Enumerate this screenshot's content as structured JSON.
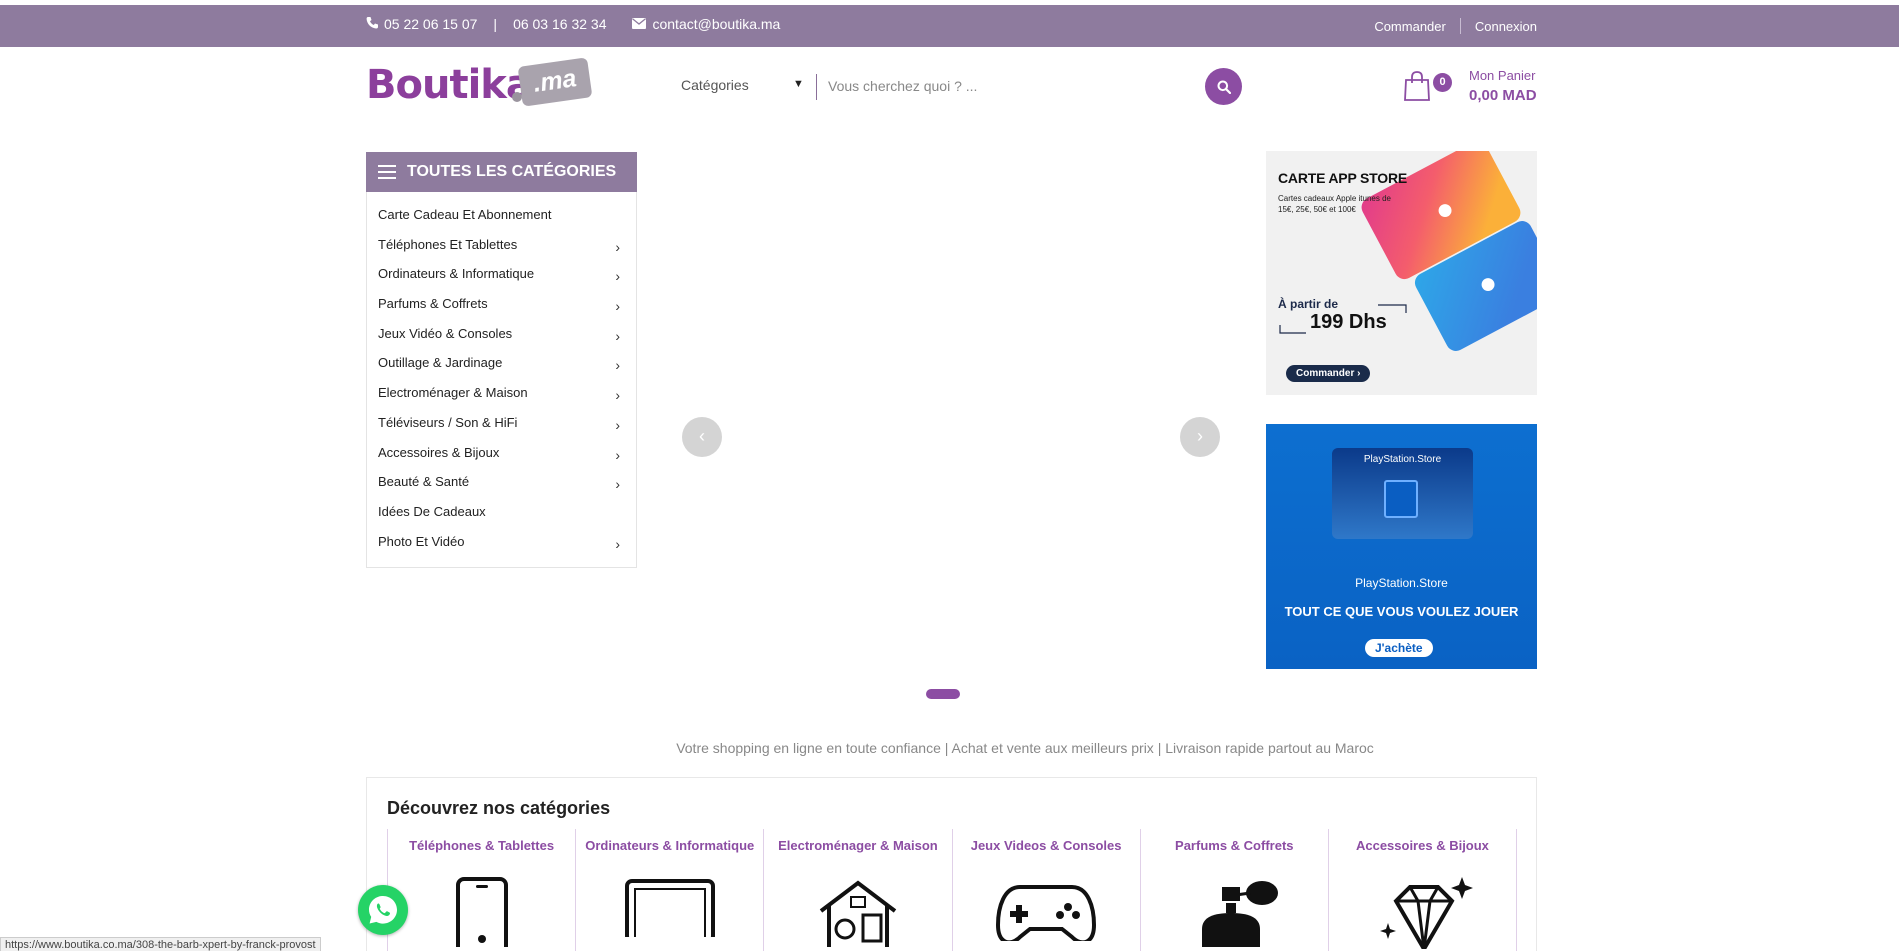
{
  "topbar": {
    "phone1": "05 22 06 15 07",
    "separator": "|",
    "phone2": "06 03 16 32 34",
    "email": "contact@boutika.ma",
    "links": [
      "Commander",
      "Connexion"
    ]
  },
  "header": {
    "logo_word": "Boutika",
    "logo_tag": ".ma",
    "category_select": "Catégories",
    "search_placeholder": "Vous cherchez quoi ? ...",
    "cart_count": "0",
    "cart_label": "Mon Panier",
    "cart_total": "0,00 MAD"
  },
  "sidebar": {
    "title": "TOUTES LES CATÉGORIES",
    "items": [
      {
        "label": "Carte Cadeau Et Abonnement",
        "has_children": false
      },
      {
        "label": "Téléphones Et Tablettes",
        "has_children": true
      },
      {
        "label": "Ordinateurs & Informatique",
        "has_children": true
      },
      {
        "label": "Parfums & Coffrets",
        "has_children": true
      },
      {
        "label": "Jeux Vidéo & Consoles",
        "has_children": true
      },
      {
        "label": "Outillage & Jardinage",
        "has_children": true
      },
      {
        "label": "Electroménager & Maison",
        "has_children": true
      },
      {
        "label": "Téléviseurs / Son & HiFi",
        "has_children": true
      },
      {
        "label": "Accessoires & Bijoux",
        "has_children": true
      },
      {
        "label": "Beauté & Santé",
        "has_children": true
      },
      {
        "label": "Idées De Cadeaux",
        "has_children": false
      },
      {
        "label": "Photo Et Vidéo",
        "has_children": true
      }
    ]
  },
  "slider": {
    "prev_icon": "chevron-left-icon",
    "next_icon": "chevron-right-icon"
  },
  "banner_appstore": {
    "title": "CARTE APP STORE",
    "subtitle": "Cartes cadeaux Apple itunes de 15€, 25€, 50€ et 100€",
    "from": "À partir de",
    "price": "199 Dhs",
    "button": "Commander"
  },
  "banner_playstation": {
    "card_label": "PlayStation.Store",
    "store": "PlayStation.Store",
    "tagline": "TOUT CE QUE VOUS VOULEZ JOUER",
    "button": "J'achète"
  },
  "tagline": "Votre shopping en ligne en toute confiance | Achat et vente aux meilleurs prix | Livraison rapide partout au Maroc",
  "discover": {
    "title": "Découvrez nos catégories",
    "items": [
      {
        "label": "Téléphones & Tablettes",
        "icon": "smartphone-icon"
      },
      {
        "label": "Ordinateurs & Informatique",
        "icon": "laptop-icon"
      },
      {
        "label": "Electroménager & Maison",
        "icon": "house-appliance-icon"
      },
      {
        "label": "Jeux Videos & Consoles",
        "icon": "gamepad-icon"
      },
      {
        "label": "Parfums & Coffrets",
        "icon": "perfume-icon"
      },
      {
        "label": "Accessoires & Bijoux",
        "icon": "diamond-icon"
      }
    ]
  },
  "status_url": "https://www.boutika.co.ma/308-the-barb-xpert-by-franck-provost",
  "colors": {
    "topbar": "#8e7b9e",
    "accent": "#8c4da3",
    "whatsapp": "#25d366"
  }
}
